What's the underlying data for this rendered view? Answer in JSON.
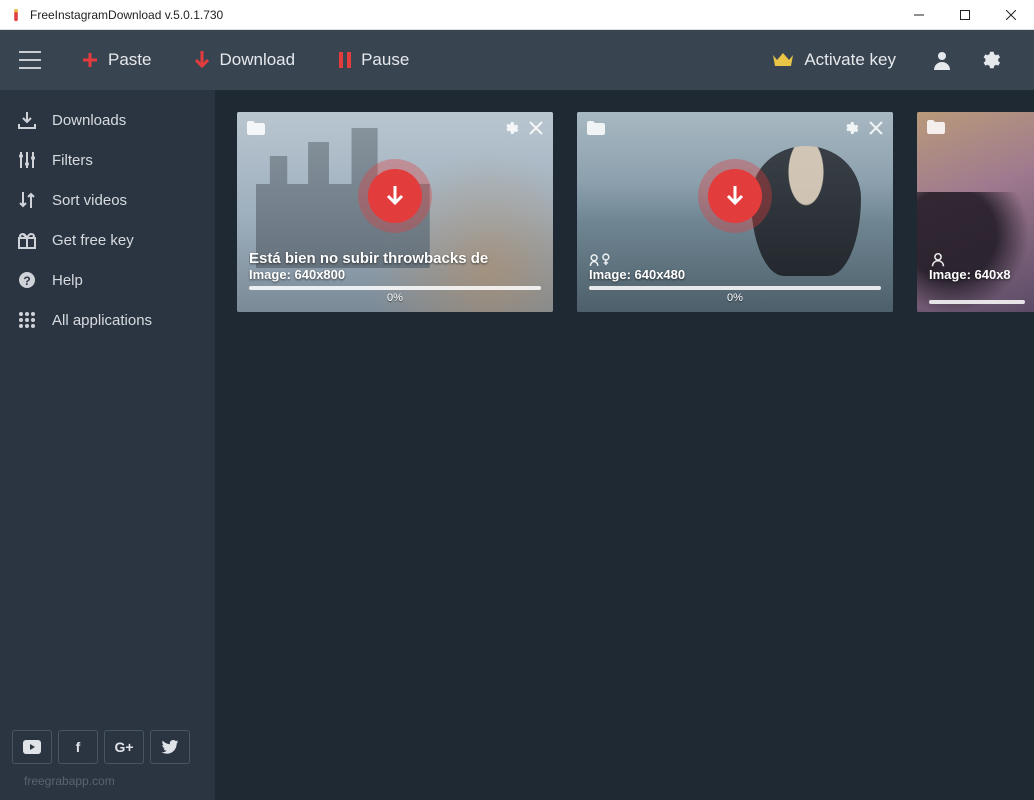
{
  "window": {
    "title": "FreeInstagramDownload  v.5.0.1.730"
  },
  "toolbar": {
    "paste": "Paste",
    "download": "Download",
    "pause": "Pause",
    "activate": "Activate key"
  },
  "sidebar": {
    "items": [
      {
        "label": "Downloads"
      },
      {
        "label": "Filters"
      },
      {
        "label": "Sort videos"
      },
      {
        "label": "Get free key"
      },
      {
        "label": "Help"
      },
      {
        "label": "All applications"
      }
    ]
  },
  "social": {
    "youtube": "▶",
    "facebook": "f",
    "gplus": "G+",
    "twitter": "t"
  },
  "footer": {
    "text": "freegrabapp.com"
  },
  "cards": [
    {
      "caption": "Está bien no subir throwbacks de",
      "dims": "Image: 640x800",
      "pct": "0%"
    },
    {
      "caption": "",
      "dims": "Image: 640x480",
      "pct": "0%",
      "usericon": true
    },
    {
      "caption": "",
      "dims": "Image: 640x8",
      "pct": "",
      "cropped": true
    }
  ],
  "colors": {
    "accent_red": "#e23c3c",
    "accent_yellow": "#e8c547",
    "bg_dark": "#1f2933",
    "bg_toolbar": "#394451",
    "bg_sidebar": "#2b3542"
  }
}
